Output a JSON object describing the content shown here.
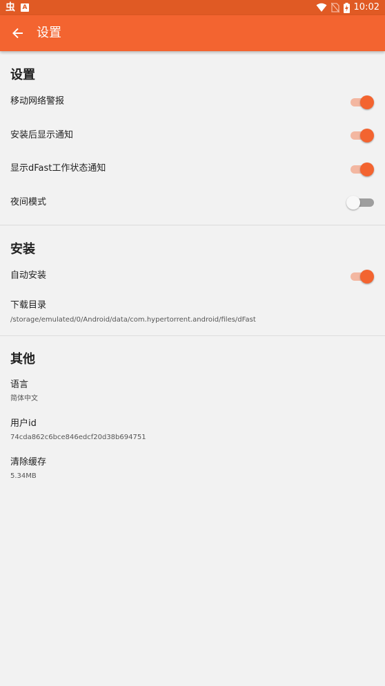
{
  "status_bar": {
    "app_icon_1": "虫",
    "app_icon_2": "A",
    "time": "10:02"
  },
  "app_bar": {
    "title": "设置"
  },
  "sections": {
    "settings": {
      "title": "设置",
      "mobile_network_alert": {
        "label": "移动网络警报",
        "on": true
      },
      "notify_after_install": {
        "label": "安装后显示通知",
        "on": true
      },
      "dfast_status_notify": {
        "label": "显示dFast工作状态通知",
        "on": true
      },
      "night_mode": {
        "label": "夜间模式",
        "on": false
      }
    },
    "install": {
      "title": "安装",
      "auto_install": {
        "label": "自动安装",
        "on": true
      },
      "download_dir": {
        "label": "下载目录",
        "value": "/storage/emulated/0/Android/data/com.hypertorrent.android/files/dFast"
      }
    },
    "other": {
      "title": "其他",
      "language": {
        "label": "语言",
        "value": "简体中文"
      },
      "user_id": {
        "label": "用户id",
        "value": "74cda862c6bce846edcf20d38b694751"
      },
      "clear_cache": {
        "label": "清除缓存",
        "value": "5.34MB"
      }
    }
  },
  "colors": {
    "accent": "#f36430",
    "status_bar": "#e05a24",
    "background": "#f2f2f2"
  }
}
